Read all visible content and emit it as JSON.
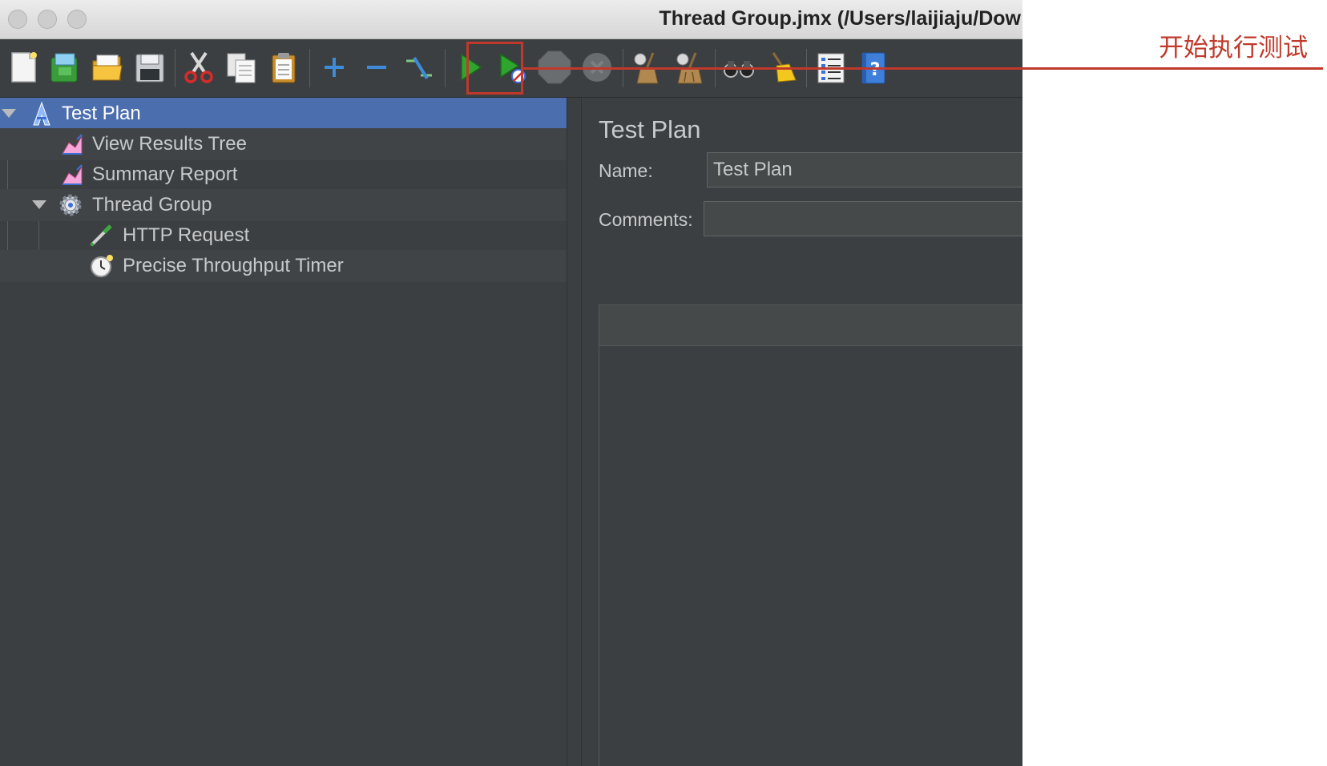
{
  "window": {
    "title": "Thread Group.jmx (/Users/laijiaju/Dow"
  },
  "toolbar": {
    "buttons": [
      {
        "name": "new",
        "icon": "new-file-icon"
      },
      {
        "name": "templates",
        "icon": "templates-icon"
      },
      {
        "name": "open",
        "icon": "open-folder-icon"
      },
      {
        "name": "save",
        "icon": "save-icon"
      },
      {
        "name": "cut",
        "icon": "scissors-icon"
      },
      {
        "name": "copy",
        "icon": "copy-icon"
      },
      {
        "name": "paste",
        "icon": "clipboard-icon"
      },
      {
        "name": "expand",
        "icon": "plus-icon"
      },
      {
        "name": "collapse",
        "icon": "minus-icon"
      },
      {
        "name": "toggle",
        "icon": "toggle-icon"
      },
      {
        "name": "start",
        "icon": "play-icon"
      },
      {
        "name": "start-no-pauses",
        "icon": "play-no-timers-icon"
      },
      {
        "name": "stop",
        "icon": "stop-icon"
      },
      {
        "name": "shutdown",
        "icon": "shutdown-icon"
      },
      {
        "name": "clear",
        "icon": "broom-icon"
      },
      {
        "name": "clear-all",
        "icon": "broom-all-icon"
      },
      {
        "name": "search",
        "icon": "binoculars-icon"
      },
      {
        "name": "reset-search",
        "icon": "broom-yellow-icon"
      },
      {
        "name": "function-helper",
        "icon": "list-icon"
      },
      {
        "name": "help",
        "icon": "help-book-icon"
      }
    ]
  },
  "tree": {
    "items": [
      {
        "label": "Test Plan",
        "icon": "test-plan-icon",
        "selected": true
      },
      {
        "label": "View Results Tree",
        "icon": "listener-chart-icon"
      },
      {
        "label": "Summary Report",
        "icon": "listener-chart-icon"
      },
      {
        "label": "Thread Group",
        "icon": "gear-icon",
        "expanded": true
      },
      {
        "label": "HTTP Request",
        "icon": "pipette-icon"
      },
      {
        "label": "Precise Throughput Timer",
        "icon": "stopwatch-icon"
      }
    ]
  },
  "panel": {
    "title": "Test Plan",
    "name_label": "Name:",
    "name_value": "Test Plan",
    "comments_label": "Comments:",
    "comments_value": ""
  },
  "annotation": {
    "text": "开始执行测试",
    "color": "#c0392b"
  },
  "colors": {
    "background": "#3c3f41",
    "selection": "#4b6eaf",
    "text": "#c7c9cb"
  }
}
